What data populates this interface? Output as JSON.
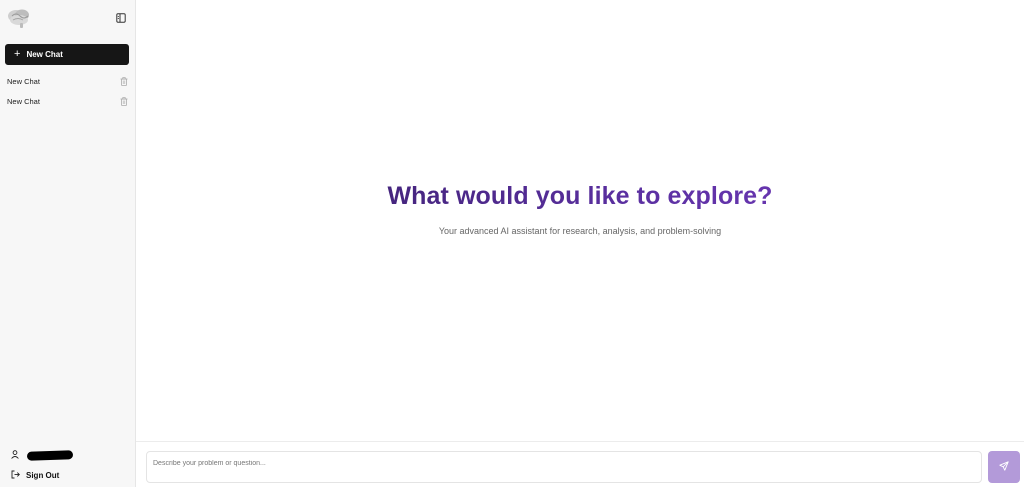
{
  "sidebar": {
    "logo_icon": "brain-icon",
    "collapse_icon": "sidebar-collapse-icon",
    "new_chat_label": "New Chat",
    "chats": [
      {
        "label": "New Chat"
      },
      {
        "label": "New Chat"
      }
    ],
    "user_icon": "user-icon",
    "sign_out_label": "Sign Out"
  },
  "main": {
    "title": "What would you like to explore?",
    "subtitle": "Your advanced AI assistant for research, analysis, and problem-solving",
    "input_placeholder": "Describe your problem or question...",
    "send_icon": "send-icon"
  },
  "colors": {
    "title_gradient_start": "#2f1a5a",
    "title_gradient_end": "#7b3fc6",
    "send_button": "#b39ad9",
    "new_chat_button": "#161616",
    "sidebar_bg": "#f7f7f7"
  }
}
